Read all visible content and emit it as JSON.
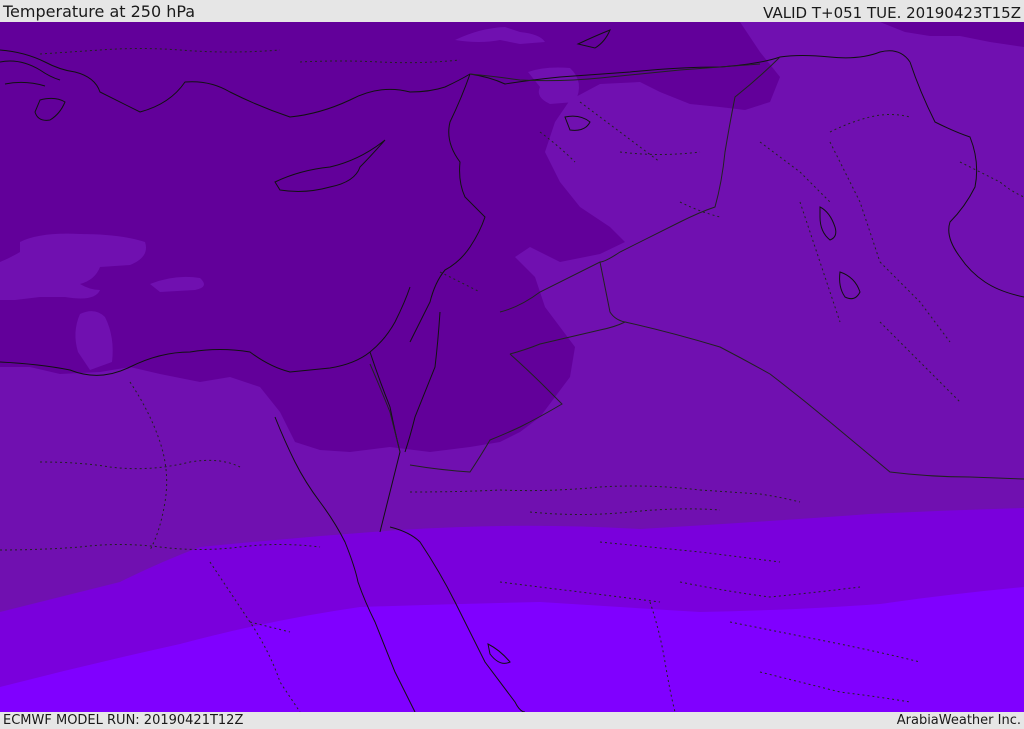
{
  "header": {
    "title": "Temperature at 250 hPa",
    "valid": "VALID T+051 TUE. 20190423T15Z"
  },
  "footer": {
    "model_run": "ECMWF MODEL RUN: 20190421T12Z",
    "credit": "ArabiaWeather Inc."
  },
  "map": {
    "region": "Eastern Mediterranean / Middle East",
    "colors": {
      "band_coldest": "#62009a",
      "band_cold": "#7010b0",
      "band_mid": "#7a00dc",
      "band_warm": "#8000ff",
      "coastline": "#111111",
      "border": "#222222"
    }
  }
}
